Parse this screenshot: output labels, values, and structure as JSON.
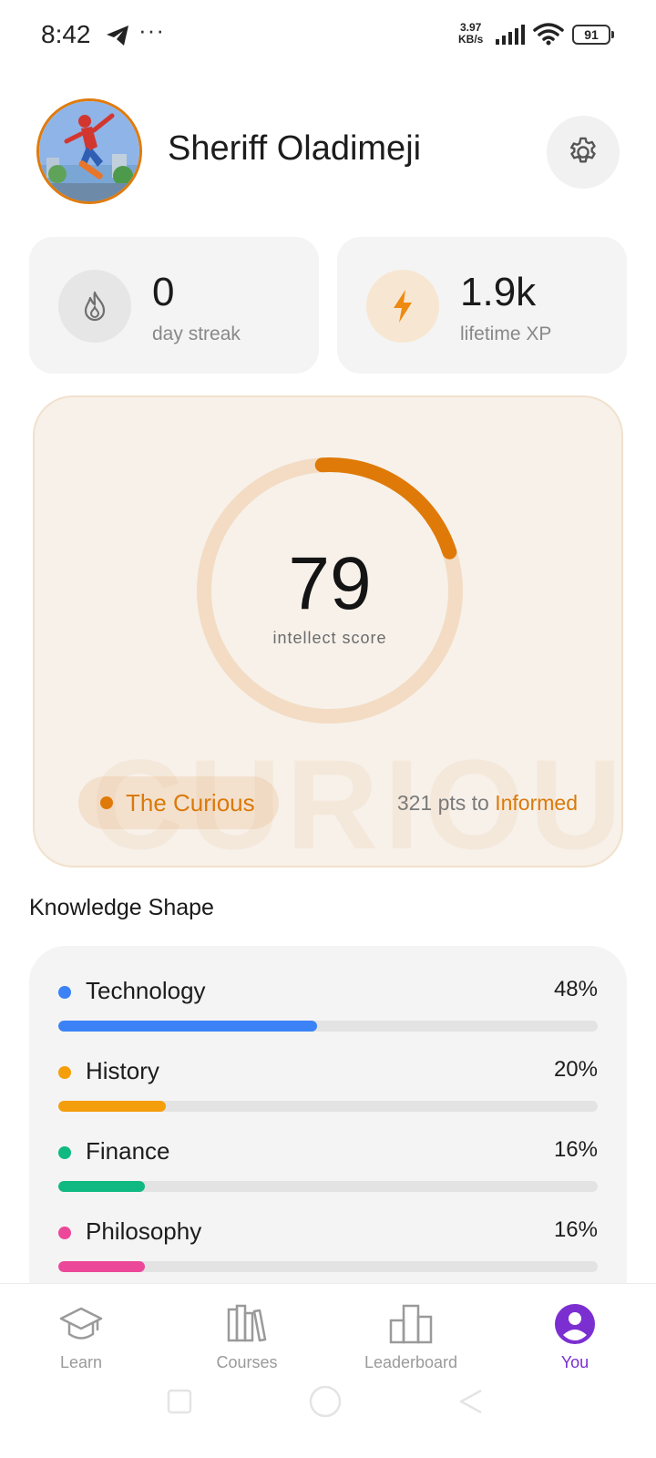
{
  "status_bar": {
    "time": "8:42",
    "more_dots": "···",
    "net_speed_value": "3.97",
    "net_speed_unit": "KB/s",
    "battery": "91"
  },
  "profile": {
    "name": "Sheriff Oladimeji"
  },
  "stats": {
    "streak": {
      "value": "0",
      "label": "day streak",
      "icon": "flame-icon"
    },
    "xp": {
      "value": "1.9k",
      "label": "lifetime XP",
      "icon": "lightning-icon"
    }
  },
  "intellect": {
    "score": "79",
    "score_label": "intellect score",
    "ring_progress_fraction": 0.21,
    "watermark": "CURIOUS",
    "rank": "The Curious",
    "points_to_next_prefix": "321 pts to",
    "next_rank": "Informed"
  },
  "knowledge_shape": {
    "title": "Knowledge Shape",
    "items": [
      {
        "name": "Technology",
        "percent_label": "48%",
        "fraction": 0.48,
        "color": "#3b82f6"
      },
      {
        "name": "History",
        "percent_label": "20%",
        "fraction": 0.2,
        "color": "#f59e0b"
      },
      {
        "name": "Finance",
        "percent_label": "16%",
        "fraction": 0.16,
        "color": "#10b981"
      },
      {
        "name": "Philosophy",
        "percent_label": "16%",
        "fraction": 0.16,
        "color": "#ec4899"
      }
    ]
  },
  "nav": {
    "items": [
      {
        "label": "Learn",
        "icon": "graduation-cap-icon"
      },
      {
        "label": "Courses",
        "icon": "books-icon"
      },
      {
        "label": "Leaderboard",
        "icon": "leaderboard-icon"
      },
      {
        "label": "You",
        "icon": "profile-icon",
        "active": true
      }
    ]
  },
  "colors": {
    "accent_orange": "#df7a08",
    "active_purple": "#7b2fd0"
  }
}
